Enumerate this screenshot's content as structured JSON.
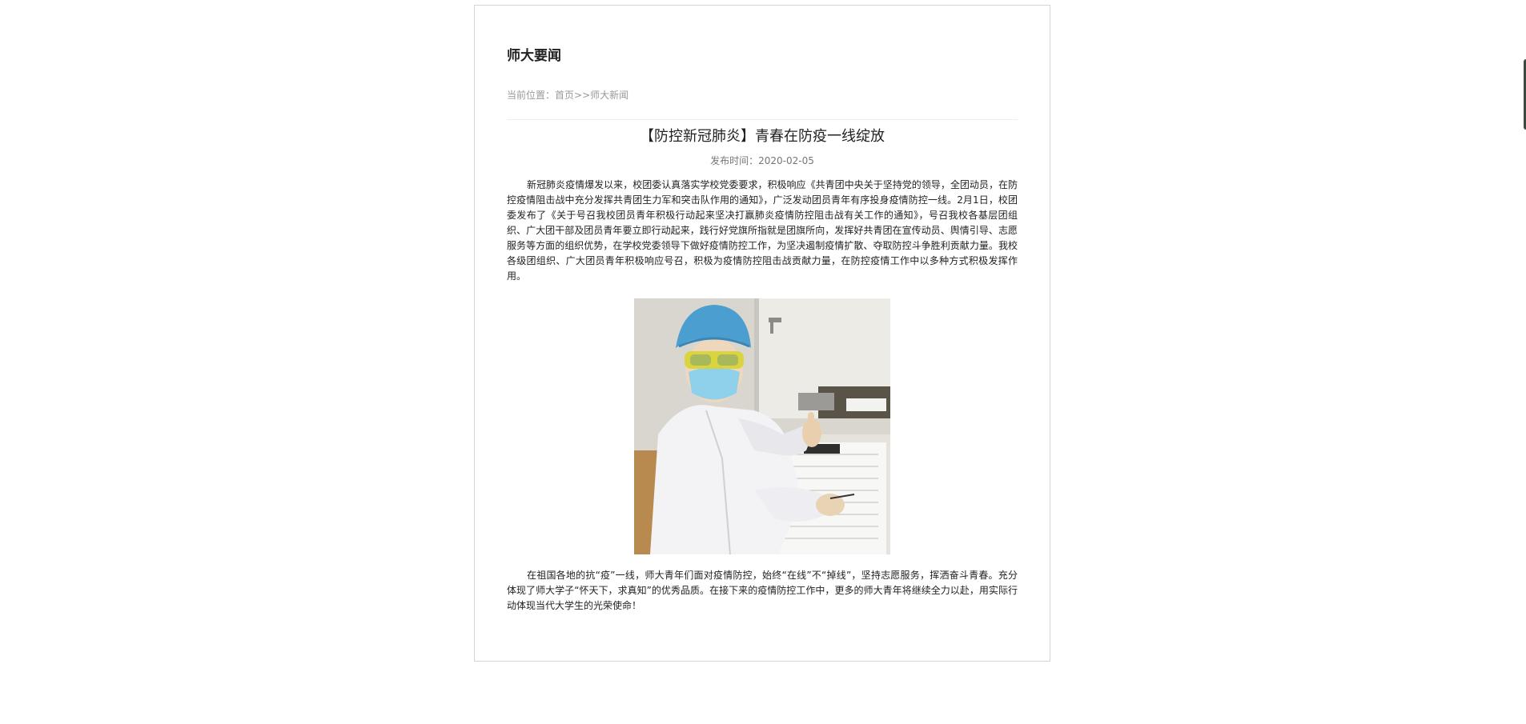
{
  "section": {
    "title": "师大要闻"
  },
  "breadcrumb": {
    "prefix": "当前位置：",
    "home": "首页",
    "separator": ">>",
    "current": "师大新闻"
  },
  "article": {
    "title": "【防控新冠肺炎】青春在防疫一线绽放",
    "pubtime_label": "发布时间：",
    "pubtime": "2020-02-05",
    "paragraph1": "新冠肺炎疫情爆发以来，校团委认真落实学校党委要求，积极响应《共青团中央关于坚持党的领导，全团动员，在防控疫情阻击战中充分发挥共青团生力军和突击队作用的通知》，广泛发动团员青年有序投身疫情防控一线。2月1日，校团委发布了《关于号召我校团员青年积极行动起来坚决打赢肺炎疫情防控阻击战有关工作的通知》，号召我校各基层团组织、广大团干部及团员青年要立即行动起来，践行好党旗所指就是团旗所向，发挥好共青团在宣传动员、舆情引导、志愿服务等方面的组织优势，在学校党委领导下做好疫情防控工作，为坚决遏制疫情扩散、夺取防控斗争胜利贡献力量。我校各级团组织、广大团员青年积极响应号召，积极为疫情防控阻击战贡献力量，在防控疫情工作中以多种方式积极发挥作用。",
    "photo_subject": "photo-medical-worker-thumbs-up",
    "paragraph2": "在祖国各地的抗“疫”一线，师大青年们面对疫情防控，始终“在线”不“掉线”，坚持志愿服务，挥洒奋斗青春。充分体现了师大学子“怀天下，求真知”的优秀品质。在接下来的疫情防控工作中，更多的师大青年将继续全力以赴，用实际行动体现当代大学生的光荣使命！"
  },
  "colors": {
    "border": "#d5d5d5",
    "muted_text": "#999999",
    "body_text": "#222222"
  }
}
